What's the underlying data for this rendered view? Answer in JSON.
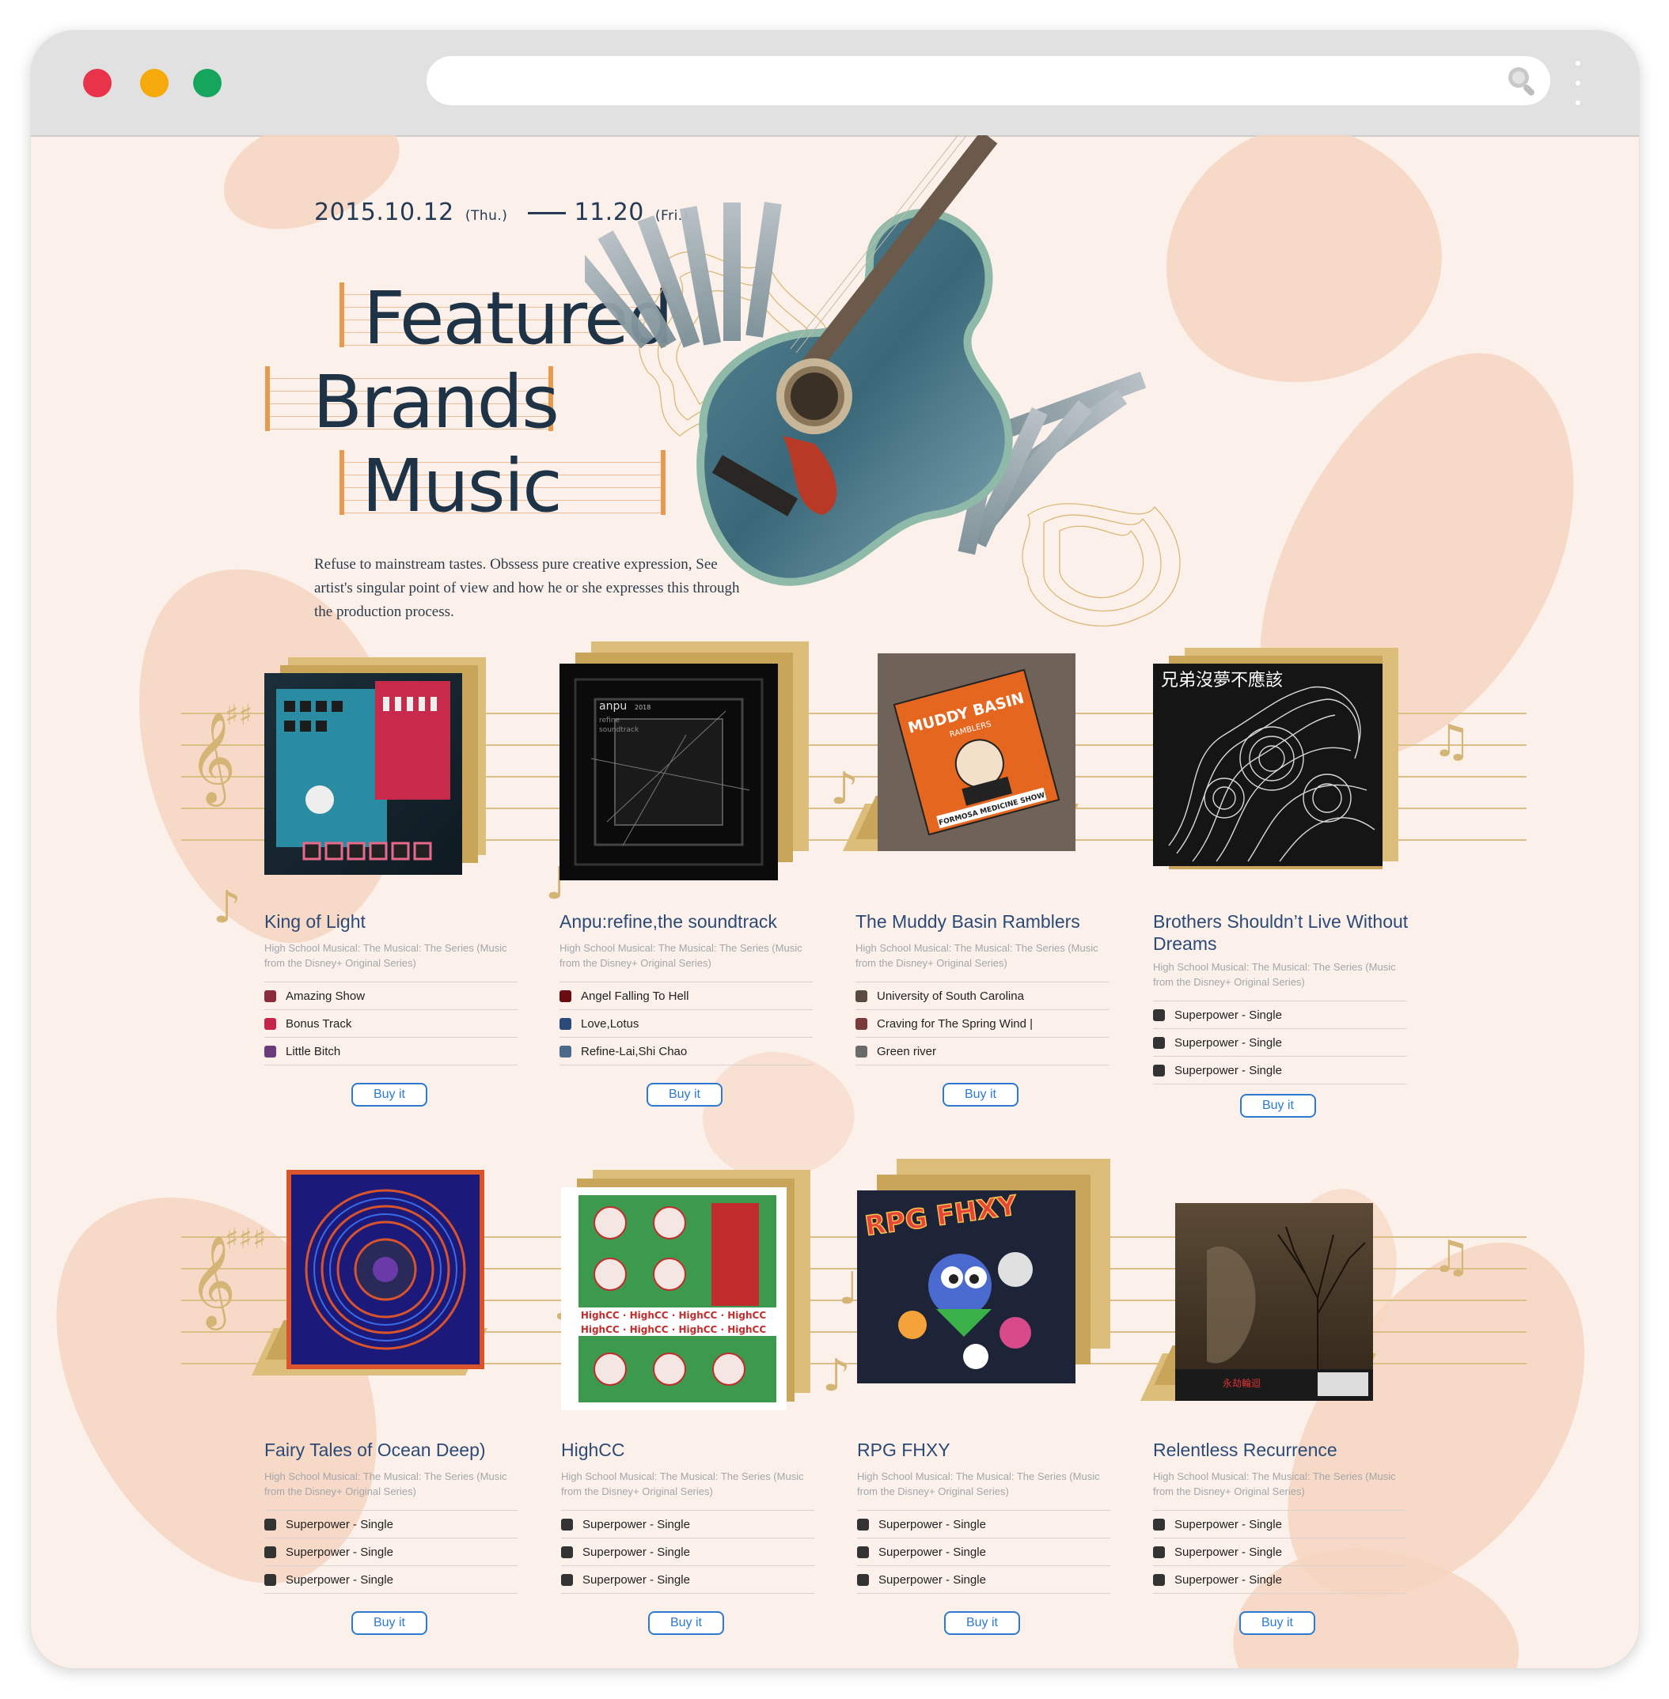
{
  "browser": {
    "url": "",
    "search_icon": "search-icon",
    "menu_icon": "kebab-menu-icon"
  },
  "hero": {
    "date_start": "2015.10.12",
    "date_start_day": "(Thu.)",
    "date_end": "11.20",
    "date_end_day": "(Fri.)",
    "title_lines": [
      "Featured",
      "Brands",
      "Music"
    ],
    "tagline": "Refuse to mainstream tastes. Obssess pure creative expression, See artist's singular point of view and how he or she expresses this through the production process."
  },
  "colors": {
    "accent": "#e79a4c",
    "link": "#2d7bd1",
    "title": "#2c4a78",
    "background": "#fbf1ea"
  },
  "albums": [
    {
      "title": "King of Light",
      "subtitle": "High School Musical: The Musical: The Series (Music from the Disney+ Original Series)",
      "tracks": [
        "Amazing Show",
        "Bonus Track",
        "Little Bitch"
      ],
      "buy_label": "Buy it"
    },
    {
      "title": "Anpu:refine,the soundtrack",
      "subtitle": "High School Musical: The Musical: The Series (Music from the Disney+ Original Series)",
      "tracks": [
        "Angel Falling To Hell",
        "Love,Lotus",
        "Refine-Lai,Shi Chao"
      ],
      "buy_label": "Buy it",
      "art_text": [
        "anpu",
        "2018",
        "refine",
        "soundtrack"
      ]
    },
    {
      "title": "The Muddy Basin Ramblers",
      "subtitle": "High School Musical: The Musical: The Series (Music from the Disney+ Original Series)",
      "tracks": [
        "University of South Carolina",
        "Craving for The Spring Wind |",
        "Green river"
      ],
      "buy_label": "Buy it",
      "art_text": [
        "MUDDY BASIN",
        "RAMBLERS",
        "FORMOSA MEDICINE SHOW"
      ]
    },
    {
      "title": "Brothers Shouldn’t Live Without Dreams",
      "subtitle": "High School Musical: The Musical: The Series (Music from the Disney+ Original Series)",
      "tracks": [
        "Superpower - Single",
        "Superpower - Single",
        "Superpower - Single"
      ],
      "buy_label": "Buy it"
    },
    {
      "title": "Fairy Tales of Ocean Deep)",
      "subtitle": "High School Musical: The Musical: The Series (Music from the Disney+ Original Series)",
      "tracks": [
        "Superpower - Single",
        "Superpower - Single",
        "Superpower - Single"
      ],
      "buy_label": "Buy it"
    },
    {
      "title": "HighCC",
      "subtitle": "High School Musical: The Musical: The Series (Music from the Disney+ Original Series)",
      "tracks": [
        "Superpower - Single",
        "Superpower - Single",
        "Superpower - Single"
      ],
      "buy_label": "Buy it",
      "art_text": [
        "HighCC · HighCC · HighCC · HighCC"
      ]
    },
    {
      "title": "RPG FHXY",
      "subtitle": "High School Musical: The Musical: The Series (Music from the Disney+ Original Series)",
      "tracks": [
        "Superpower - Single",
        "Superpower - Single",
        "Superpower - Single"
      ],
      "buy_label": "Buy it",
      "art_text": [
        "RPG FHXY"
      ]
    },
    {
      "title": "Relentless Recurrence",
      "subtitle": "High School Musical: The Musical: The Series (Music from the Disney+ Original Series)",
      "tracks": [
        "Superpower - Single",
        "Superpower - Single",
        "Superpower - Single"
      ],
      "buy_label": "Buy it"
    }
  ]
}
